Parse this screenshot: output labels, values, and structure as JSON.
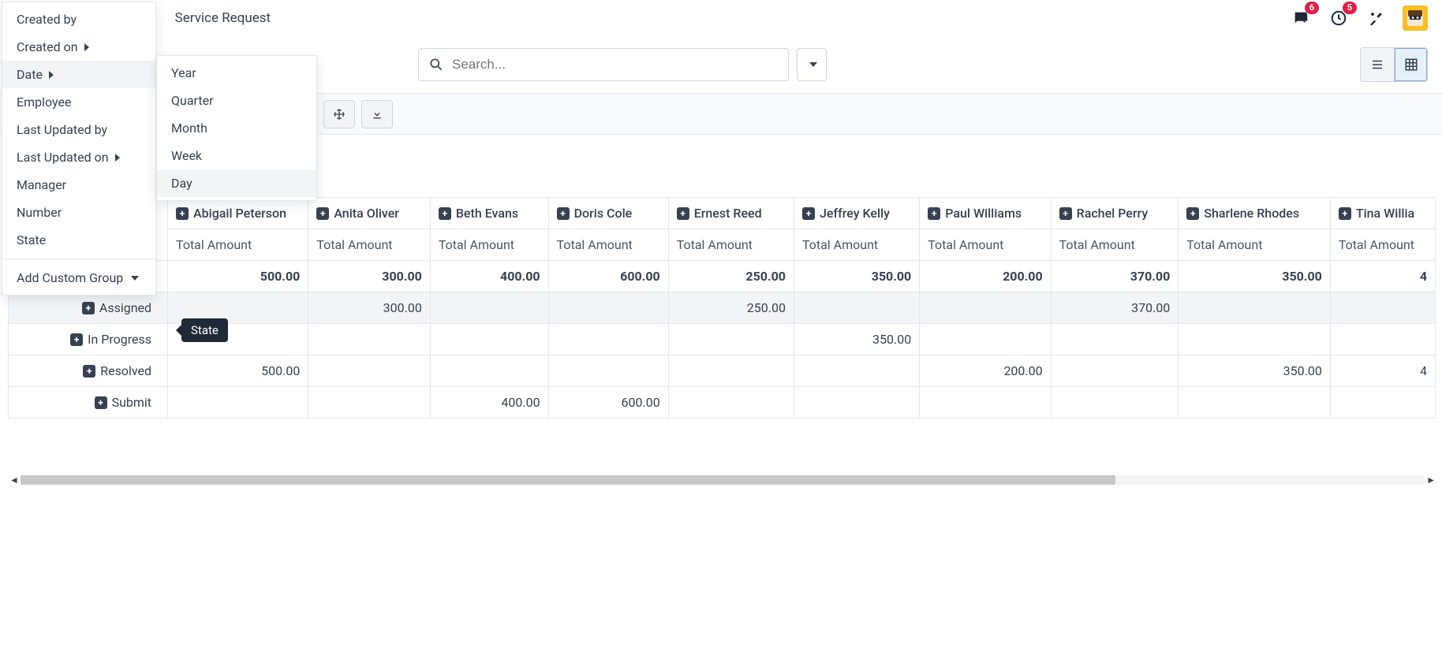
{
  "header": {
    "truncated": "t",
    "title": "Service Request",
    "msg_badge": "6",
    "clock_badge": "5"
  },
  "search": {
    "placeholder": "Search..."
  },
  "groupby_menu": {
    "items": [
      {
        "label": "Created by",
        "submenu": false
      },
      {
        "label": "Created on",
        "submenu": true
      },
      {
        "label": "Date",
        "submenu": true,
        "hover": true
      },
      {
        "label": "Employee",
        "submenu": false
      },
      {
        "label": "Last Updated by",
        "submenu": false
      },
      {
        "label": "Last Updated on",
        "submenu": true
      },
      {
        "label": "Manager",
        "submenu": false
      },
      {
        "label": "Number",
        "submenu": false
      },
      {
        "label": "State",
        "submenu": false
      }
    ],
    "add_custom": "Add Custom Group"
  },
  "date_submenu": {
    "items": [
      {
        "label": "Year"
      },
      {
        "label": "Quarter"
      },
      {
        "label": "Month"
      },
      {
        "label": "Week"
      },
      {
        "label": "Day",
        "hover": true
      }
    ]
  },
  "tooltip": "State",
  "pivot": {
    "col_sub_label": "Total Amount",
    "columns": [
      {
        "label": "Abigail Peterson"
      },
      {
        "label": "Anita Oliver"
      },
      {
        "label": "Beth Evans"
      },
      {
        "label": "Doris Cole"
      },
      {
        "label": "Ernest Reed"
      },
      {
        "label": "Jeffrey Kelly"
      },
      {
        "label": "Paul Williams"
      },
      {
        "label": "Rachel Perry"
      },
      {
        "label": "Sharlene Rhodes"
      },
      {
        "label": "Tina Willia"
      }
    ],
    "totals": [
      "500.00",
      "300.00",
      "400.00",
      "600.00",
      "250.00",
      "350.00",
      "200.00",
      "370.00",
      "350.00",
      "4"
    ],
    "rows": [
      {
        "label": "Assigned",
        "hover": true,
        "cells": [
          "",
          "300.00",
          "",
          "",
          "250.00",
          "",
          "",
          "370.00",
          "",
          ""
        ]
      },
      {
        "label": "In Progress",
        "cells": [
          "",
          "",
          "",
          "",
          "",
          "350.00",
          "",
          "",
          "",
          ""
        ]
      },
      {
        "label": "Resolved",
        "cells": [
          "500.00",
          "",
          "",
          "",
          "",
          "",
          "200.00",
          "",
          "350.00",
          "4"
        ]
      },
      {
        "label": "Submit",
        "cells": [
          "",
          "",
          "400.00",
          "600.00",
          "",
          "",
          "",
          "",
          "",
          ""
        ]
      }
    ]
  }
}
